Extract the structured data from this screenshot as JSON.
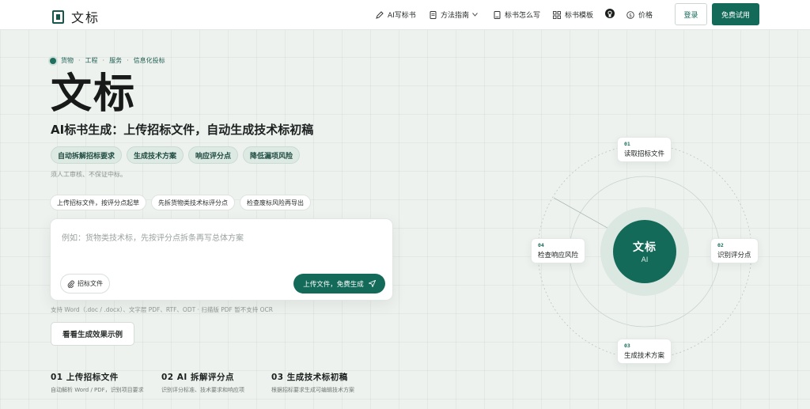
{
  "header": {
    "logo_text": "文标",
    "nav": [
      {
        "label": "AI写标书",
        "icon": "pen-icon"
      },
      {
        "label": "方法指南",
        "icon": "document-icon"
      },
      {
        "label": "标书怎么写",
        "icon": "book-icon"
      },
      {
        "label": "标书模板",
        "icon": "grid-icon"
      },
      {
        "label": "",
        "icon": "github-icon"
      },
      {
        "label": "价格",
        "icon": "dollar-icon"
      }
    ],
    "login_label": "登录",
    "trial_label": "免费试用"
  },
  "hero": {
    "crumbs": [
      "货物",
      "工程",
      "服务",
      "信息化投标"
    ],
    "title": "文标",
    "subtitle": "AI标书生成：上传招标文件，自动生成技术标初稿",
    "tags": [
      "自动拆解招标要求",
      "生成技术方案",
      "响应评分点",
      "降低漏项风险"
    ],
    "note": "须人工审核、不保证中标。",
    "chips": [
      "上传招标文件，按评分点起草",
      "先拆货物类技术标评分点",
      "检查废标风险再导出"
    ],
    "input_placeholder": "例如：货物类技术标，先按评分点拆条再写总体方案",
    "attach_label": "招标文件",
    "upload_label": "上传文件，免费生成",
    "formats": "支持 Word（.doc / .docx）、文字层 PDF、RTF、ODT · 扫描版 PDF 暂不支持 OCR",
    "example_label": "看看生成效果示例"
  },
  "steps": [
    {
      "title": "01 上传招标文件",
      "desc": "自动解析 Word / PDF，识别项目要求"
    },
    {
      "title": "02 AI 拆解评分点",
      "desc": "识别评分标准、技术要求和响应项"
    },
    {
      "title": "03 生成技术标初稿",
      "desc": "根据招标要求生成可编辑技术方案"
    }
  ],
  "diagram": {
    "center_title": "文标",
    "center_sub": "AI",
    "nodes": [
      {
        "num": "01",
        "label": "读取招标文件"
      },
      {
        "num": "02",
        "label": "识别评分点"
      },
      {
        "num": "03",
        "label": "生成技术方案"
      },
      {
        "num": "04",
        "label": "检查响应风险"
      }
    ]
  },
  "colors": {
    "brand": "#136a59",
    "background": "#eef2ef",
    "tag_bg": "#dde9e3"
  }
}
